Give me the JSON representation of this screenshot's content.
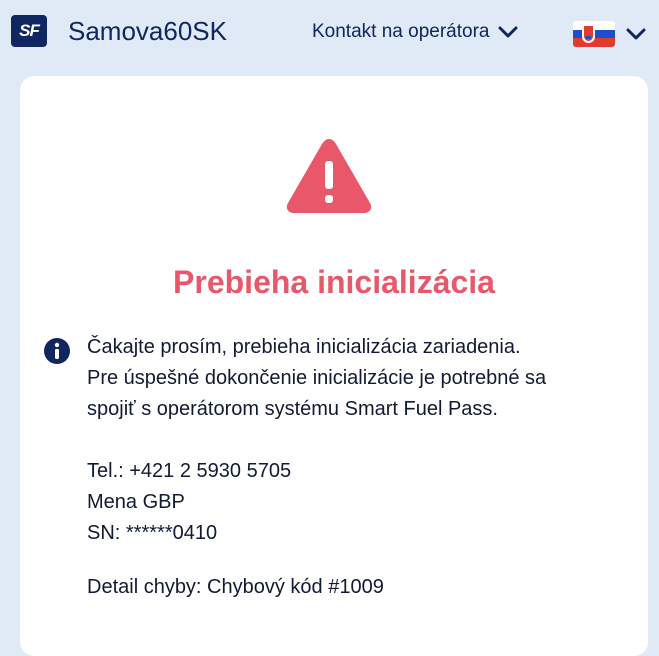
{
  "header": {
    "logo_text": "SF",
    "app_name": "Samova60SK",
    "contact_label": "Kontakt na operátora",
    "language_flag": "slovakia-flag-icon"
  },
  "alert": {
    "icon": "warning-triangle-icon",
    "icon_color": "#e8586a",
    "title": "Prebieha inicializácia",
    "info_icon": "info-icon",
    "message_lines": [
      "Čakajte prosím, prebieha inicializácia zariadenia.",
      "Pre úspešné dokončenie inicializácie je potrebné sa",
      "spojiť s operátorom systému Smart Fuel Pass."
    ],
    "details": {
      "phone": "Tel.: +421 2 5930 5705",
      "currency": "Mena GBP",
      "serial": "SN: ******0410"
    },
    "error": "Detail chyby: Chybový kód #1009"
  },
  "colors": {
    "brand": "#102661",
    "background": "#dfeaf6",
    "alert_red": "#e8586a"
  }
}
